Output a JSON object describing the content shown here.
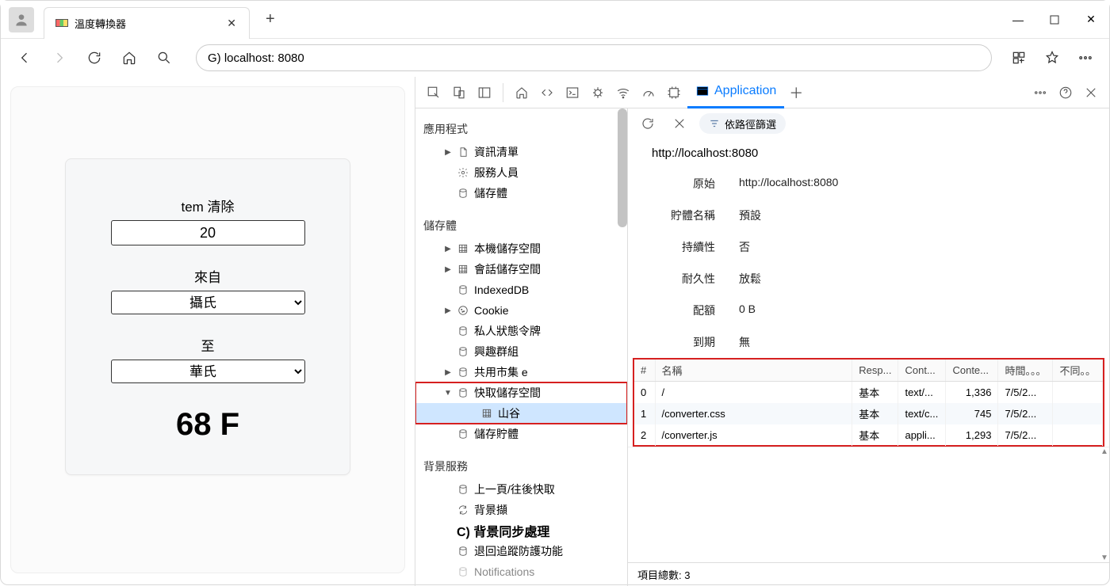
{
  "window": {
    "tab_title": "溫度轉換器",
    "new_tab_label": "+",
    "minimize": "—",
    "maximize": "□",
    "close": "✕"
  },
  "toolbar": {
    "address": "G)  localhost: 8080"
  },
  "page": {
    "label_tem": "tem 清除",
    "input_value": "20",
    "label_from": "來自",
    "select_from": "攝氏",
    "label_to": "至",
    "select_to": "華氏",
    "result": "68 F"
  },
  "devtools": {
    "active_tab": "Application",
    "sidebar": {
      "h_app": "應用程式",
      "manifest": "資訊清單",
      "sw": "服務人員",
      "storage": "儲存體",
      "h_storage": "儲存體",
      "localstorage": "本機儲存空間",
      "sessionstorage": "會話儲存空間",
      "idb": "IndexedDB",
      "cookie": "Cookie",
      "pst": "私人狀態令牌",
      "ig": "興趣群組",
      "shared": "共用市集 e",
      "cache": "快取儲存空間",
      "cache_child": "山谷",
      "storage_buckets": "儲存貯體",
      "h_bg": "背景服務",
      "bfcache": "上一頁/往後快取",
      "bgfetch": "背景擷",
      "bgsync": "C) 背景同步處理",
      "bounce": "退回追蹤防護功能",
      "notif": "Notifications"
    },
    "detail": {
      "filter_placeholder": "依路徑篩選",
      "title_url": "http://localhost:8080",
      "k_origin": "原始",
      "v_origin": "http://localhost:8080",
      "k_name": "貯體名稱",
      "v_name": "預設",
      "k_persist": "持續性",
      "v_persist": "否",
      "k_durab": "耐久性",
      "v_durab": "放鬆",
      "k_quota": "配額",
      "v_quota": "0 B",
      "k_expire": "到期",
      "v_expire": "無"
    },
    "table": {
      "headers": {
        "idx": "#",
        "name": "名稱",
        "resp": "Resp...",
        "ct": "Cont...",
        "cl": "Conte...",
        "time": "時間。。。",
        "vary": "不同。。"
      },
      "rows": [
        {
          "idx": "0",
          "name": "/",
          "resp": "基本",
          "ct": "text/...",
          "cl": "1,336",
          "time": "7/5/2...",
          "vary": ""
        },
        {
          "idx": "1",
          "name": "/converter.css",
          "resp": "基本",
          "ct": "text/c...",
          "cl": "745",
          "time": "7/5/2...",
          "vary": ""
        },
        {
          "idx": "2",
          "name": "/converter.js",
          "resp": "基本",
          "ct": "appli...",
          "cl": "1,293",
          "time": "7/5/2...",
          "vary": ""
        }
      ]
    },
    "status": "項目總數: 3"
  }
}
